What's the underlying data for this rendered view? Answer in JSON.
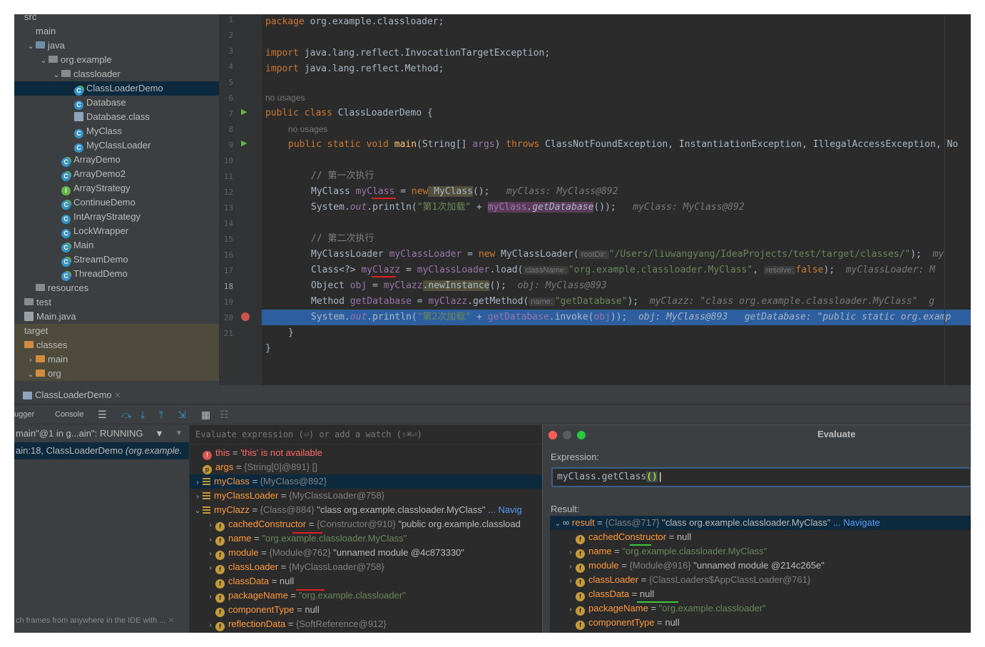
{
  "project_tree": [
    {
      "label": "src",
      "indent": 0,
      "icon": "none",
      "chev": ""
    },
    {
      "label": "main",
      "indent": 1,
      "icon": "none",
      "chev": ""
    },
    {
      "label": "java",
      "indent": 1,
      "icon": "folder-blue",
      "chev": "v"
    },
    {
      "label": "org.example",
      "indent": 2,
      "icon": "package",
      "chev": "v"
    },
    {
      "label": "classloader",
      "indent": 3,
      "icon": "package",
      "chev": "v"
    },
    {
      "label": "ClassLoaderDemo",
      "indent": 4,
      "icon": "class-run",
      "chev": "",
      "selected": true
    },
    {
      "label": "Database",
      "indent": 4,
      "icon": "class",
      "chev": ""
    },
    {
      "label": "Database.class",
      "indent": 4,
      "icon": "binary",
      "chev": ""
    },
    {
      "label": "MyClass",
      "indent": 4,
      "icon": "class",
      "chev": ""
    },
    {
      "label": "MyClassLoader",
      "indent": 4,
      "icon": "class",
      "chev": ""
    },
    {
      "label": "ArrayDemo",
      "indent": 3,
      "icon": "class-run",
      "chev": ""
    },
    {
      "label": "ArrayDemo2",
      "indent": 3,
      "icon": "class-run",
      "chev": ""
    },
    {
      "label": "ArrayStrategy",
      "indent": 3,
      "icon": "interface",
      "chev": ""
    },
    {
      "label": "ContinueDemo",
      "indent": 3,
      "icon": "class-run",
      "chev": ""
    },
    {
      "label": "IntArrayStrategy",
      "indent": 3,
      "icon": "class",
      "chev": ""
    },
    {
      "label": "LockWrapper",
      "indent": 3,
      "icon": "class",
      "chev": ""
    },
    {
      "label": "Main",
      "indent": 3,
      "icon": "class-run",
      "chev": ""
    },
    {
      "label": "StreamDemo",
      "indent": 3,
      "icon": "class-run",
      "chev": ""
    },
    {
      "label": "ThreadDemo",
      "indent": 3,
      "icon": "class-run",
      "chev": ""
    },
    {
      "label": "resources",
      "indent": 1,
      "icon": "folder-res",
      "chev": ""
    },
    {
      "label": "test",
      "indent": 0,
      "icon": "folder-gray",
      "chev": ""
    },
    {
      "label": "Main.java",
      "indent": 0,
      "icon": "java-file",
      "chev": ""
    },
    {
      "label": "target",
      "indent": 0,
      "icon": "none",
      "chev": "",
      "highlight": true
    },
    {
      "label": "classes",
      "indent": 0,
      "icon": "folder-orange",
      "chev": "",
      "highlight": true
    },
    {
      "label": "main",
      "indent": 1,
      "icon": "folder-orange",
      "chev": ">",
      "highlight": true
    },
    {
      "label": "org",
      "indent": 1,
      "icon": "folder-orange",
      "chev": "v",
      "highlight": true
    }
  ],
  "gutter": {
    "lines": [
      "1",
      "2",
      "3",
      "4",
      "5",
      "6",
      "7",
      "8",
      "9",
      "10",
      "11",
      "12",
      "13",
      "14",
      "15",
      "16",
      "17",
      "18",
      "19",
      "20",
      "21"
    ],
    "current": "18"
  },
  "code": {
    "l1_kw": "package",
    "l1_rest": " org.example.classloader;",
    "l3_kw": "import",
    "l3_rest": " java.lang.reflect.InvocationTargetException;",
    "l4_kw": "import",
    "l4_rest": " java.lang.reflect.Method;",
    "no_usages": "no usages",
    "l6_kw": "public class",
    "l6_rest": " ClassLoaderDemo {",
    "l7_kw1": "public static void",
    "l7_fn": "main",
    "l7_a": "(String[] ",
    "l7_arg": "args",
    "l7_b": ") ",
    "l7_kw2": "throws",
    "l7_c": " ClassNotFoundException, InstantiationException, IllegalAccessException, No",
    "l9_cm": "// 第一次执行",
    "l10_a": "MyClass ",
    "l10_v": "myClass",
    "l10_b": " = ",
    "l10_kw": "new",
    "l10_c": " MyClass",
    "l10_d": "();",
    "l10_dbg": "myClass: MyClass@892",
    "l11_a": "System.",
    "l11_out": "out",
    "l11_b": ".println(",
    "l11_s": "\"第1次加载\"",
    "l11_c": " + ",
    "l11_v": "myClass",
    "l11_d": ".getDatabase",
    "l11_e": "());",
    "l11_dbg": "myClass: MyClass@892",
    "l13_cm": "// 第二次执行",
    "l14_a": "MyClassLoader ",
    "l14_v": "myClassLoader",
    "l14_b": " = ",
    "l14_kw": "new",
    "l14_c": " MyClassLoader(",
    "l14_ph": "rootDir:",
    "l14_s": "\"/Users/liuwangyang/IdeaProjects/test/target/classes/\"",
    "l14_d": ");",
    "l14_dbg": "my",
    "l15_a": "Class<?> ",
    "l15_v": "myClazz",
    "l15_b": " = ",
    "l15_v2": "myClassLoader",
    "l15_c": ".load(",
    "l15_ph": "className:",
    "l15_s": "\"org.example.classloader.MyClass\"",
    "l15_d": ", ",
    "l15_ph2": "resolve:",
    "l15_kw": "false",
    "l15_e": ");",
    "l15_dbg": "myClassLoader: M",
    "l16_a": "Object ",
    "l16_v": "obj",
    "l16_b": " = ",
    "l16_v2": "myClazz",
    "l16_c": ".newInstance",
    "l16_d": "();",
    "l16_dbg": "obj: MyClass@893",
    "l17_a": "Method ",
    "l17_v": "getDatabase",
    "l17_b": " = ",
    "l17_v2": "myClazz",
    "l17_c": ".getMethod(",
    "l17_ph": "name:",
    "l17_s": "\"getDatabase\"",
    "l17_d": ");",
    "l17_dbg": "myClazz: \"class org.example.classloader.MyClass\"",
    "l17_dbg2": "g",
    "l18_a": "System.",
    "l18_out": "out",
    "l18_b": ".println(",
    "l18_s": "\"第2次加载\"",
    "l18_c": " + ",
    "l18_v": "getDatabase",
    "l18_d": ".invoke(",
    "l18_v2": "obj",
    "l18_e": "));",
    "l18_dbg": "obj: MyClass@893",
    "l18_dbg2": "getDatabase: \"public static org.examp",
    "l19": "}",
    "l20": "}"
  },
  "debug": {
    "tab_label": "ClassLoaderDemo",
    "toolbar": {
      "debugger": "ugger",
      "console": "Console"
    },
    "frames": {
      "thread": "main\"@1 in g...ain\": RUNNING",
      "frame": "ain:18, ClassLoaderDemo ",
      "frame_pkg": "(org.example.",
      "footer": "ch frames from anywhere in the IDE with ..."
    },
    "eval_placeholder": "Evaluate expression (⏎) or add a watch (⇧⌘⏎)",
    "vars": [
      {
        "icon": "error",
        "arrow": "",
        "name": "this",
        "eq": " = ",
        "val": "'this' is not available",
        "cls": "err",
        "indent": 0
      },
      {
        "icon": "p",
        "arrow": "",
        "name": "args",
        "eq": " = ",
        "val": "{String[0]@891} []",
        "cls": "gray",
        "indent": 0
      },
      {
        "icon": "list",
        "arrow": ">",
        "name": "myClass",
        "eq": " = ",
        "val": "{MyClass@892}",
        "cls": "gray",
        "indent": 0,
        "selected": true
      },
      {
        "icon": "list",
        "arrow": ">",
        "name": "myClassLoader",
        "eq": " = ",
        "val": "{MyClassLoader@758}",
        "cls": "gray",
        "indent": 0
      },
      {
        "icon": "list",
        "arrow": "v",
        "name": "myClazz",
        "eq": " = ",
        "val": "{Class@884} ",
        "val2": "\"class org.example.classloader.MyClass\"",
        "val3": " ... Navig",
        "cls": "gray",
        "indent": 0
      },
      {
        "icon": "f",
        "arrow": ">",
        "name": "cachedConstructor",
        "eq": " = ",
        "val": "{Constructor@910} ",
        "val2": "\"public org.example.classload",
        "cls": "gray",
        "indent": 1
      },
      {
        "icon": "f",
        "arrow": ">",
        "name": "name",
        "eq": " = ",
        "val": "\"org.example.classloader.MyClass\"",
        "cls": "str",
        "indent": 1
      },
      {
        "icon": "f",
        "arrow": ">",
        "name": "module",
        "eq": " = ",
        "val": "{Module@762} ",
        "val2": "\"unnamed module @4c873330\"",
        "cls": "gray",
        "indent": 1
      },
      {
        "icon": "f",
        "arrow": ">",
        "name": "classLoader",
        "eq": " = ",
        "val": "{MyClassLoader@758}",
        "cls": "gray",
        "indent": 1
      },
      {
        "icon": "f",
        "arrow": "",
        "name": "classData",
        "eq": " = ",
        "val": "null",
        "cls": "white",
        "indent": 1
      },
      {
        "icon": "f",
        "arrow": ">",
        "name": "packageName",
        "eq": " = ",
        "val": "\"org.example.classloader\"",
        "cls": "str",
        "indent": 1
      },
      {
        "icon": "f",
        "arrow": "",
        "name": "componentType",
        "eq": " = ",
        "val": "null",
        "cls": "white",
        "indent": 1
      },
      {
        "icon": "f",
        "arrow": ">",
        "name": "reflectionData",
        "eq": " = ",
        "val": "{SoftReference@912}",
        "cls": "gray",
        "indent": 1
      }
    ]
  },
  "evaluate": {
    "title": "Evaluate",
    "expression_label": "Expression:",
    "expression": "myClass.getClass",
    "expression_parens": "()",
    "result_label": "Result:",
    "rows": [
      {
        "icon": "oo",
        "arrow": "v",
        "name": "result",
        "eq": " = ",
        "val": "{Class@717} ",
        "val2": "\"class org.example.classloader.MyClass\"",
        "val3": " ... Navigate",
        "cls": "gray",
        "indent": 0,
        "selected": true
      },
      {
        "icon": "f",
        "arrow": "",
        "name": "cachedConstructor",
        "eq": " = ",
        "val": "null",
        "cls": "white",
        "indent": 1
      },
      {
        "icon": "f",
        "arrow": ">",
        "name": "name",
        "eq": " = ",
        "val": "\"org.example.classloader.MyClass\"",
        "cls": "str",
        "indent": 1
      },
      {
        "icon": "f",
        "arrow": ">",
        "name": "module",
        "eq": " = ",
        "val": "{Module@916} ",
        "val2": "\"unnamed module @214c265e\"",
        "cls": "gray",
        "indent": 1
      },
      {
        "icon": "f",
        "arrow": ">",
        "name": "classLoader",
        "eq": " = ",
        "val": "{ClassLoaders$AppClassLoader@761}",
        "cls": "gray",
        "indent": 1
      },
      {
        "icon": "f",
        "arrow": "",
        "name": "classData",
        "eq": " = ",
        "val": "null",
        "cls": "white",
        "indent": 1
      },
      {
        "icon": "f",
        "arrow": ">",
        "name": "packageName",
        "eq": " = ",
        "val": "\"org.example.classloader\"",
        "cls": "str",
        "indent": 1
      },
      {
        "icon": "f",
        "arrow": "",
        "name": "componentType",
        "eq": " = ",
        "val": "null",
        "cls": "white",
        "indent": 1
      }
    ]
  },
  "colors": {
    "keyword": "#cc7832",
    "string": "#6a8759",
    "field": "#9876aa",
    "accent": "#3592c4",
    "var_name": "#ff9a3c"
  }
}
